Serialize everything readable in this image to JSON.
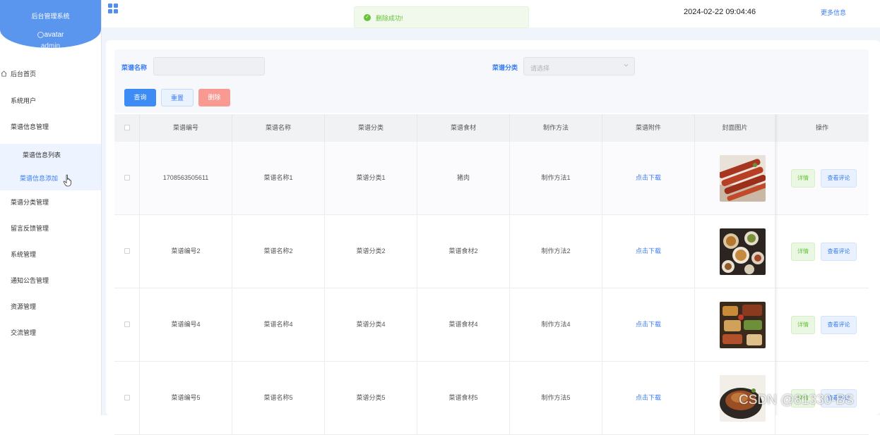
{
  "sidebar": {
    "system_title": "后台管理系统",
    "avatar_alt": "avatar",
    "username": "admin",
    "items": [
      {
        "label": "后台首页"
      },
      {
        "label": "系统用户"
      },
      {
        "label": "菜谱信息管理"
      },
      {
        "label": "菜谱信息列表"
      },
      {
        "label": "菜谱信息添加"
      },
      {
        "label": "菜谱分类管理"
      },
      {
        "label": "留言反馈管理"
      },
      {
        "label": "系统管理"
      },
      {
        "label": "通知公告管理"
      },
      {
        "label": "资源管理"
      },
      {
        "label": "交流管理"
      }
    ]
  },
  "topbar": {
    "datetime": "2024-02-22 09:04:46",
    "more_info": "更多信息"
  },
  "toast": {
    "message": "删除成功!",
    "status": "success",
    "color": "#67c23a"
  },
  "search": {
    "name_label": "菜谱名称",
    "name_value": "",
    "category_label": "菜谱分类",
    "category_placeholder": "请选择",
    "query_button": "查询",
    "reset_button": "重置",
    "delete_button": "删除"
  },
  "table": {
    "columns": [
      "菜谱编号",
      "菜谱名称",
      "菜谱分类",
      "菜谱食材",
      "制作方法",
      "菜谱附件",
      "封面图片",
      "操作"
    ],
    "rows": [
      {
        "id": "1708563505611",
        "name": "菜谱名称1",
        "category": "菜谱分类1",
        "ingredients": "猪肉",
        "method": "制作方法1",
        "attachment": "点击下载",
        "detail": "详情",
        "review": "查看评论"
      },
      {
        "id": "菜谱编号2",
        "name": "菜谱名称2",
        "category": "菜谱分类2",
        "ingredients": "菜谱食材2",
        "method": "制作方法2",
        "attachment": "点击下载",
        "detail": "详情",
        "review": "查看评论"
      },
      {
        "id": "菜谱编号4",
        "name": "菜谱名称4",
        "category": "菜谱分类4",
        "ingredients": "菜谱食材4",
        "method": "制作方法4",
        "attachment": "点击下载",
        "detail": "详情",
        "review": "查看评论"
      },
      {
        "id": "菜谱编号5",
        "name": "菜谱名称5",
        "category": "菜谱分类5",
        "ingredients": "菜谱食材5",
        "method": "制作方法5",
        "attachment": "点击下载",
        "detail": "详情",
        "review": "查看评论"
      }
    ]
  },
  "watermark": "CSDN @81330-BS",
  "colors": {
    "primary": "#3d8bf5",
    "sidebar_header": "#5b96ee",
    "danger": "#f89a91",
    "success": "#67c23a"
  }
}
